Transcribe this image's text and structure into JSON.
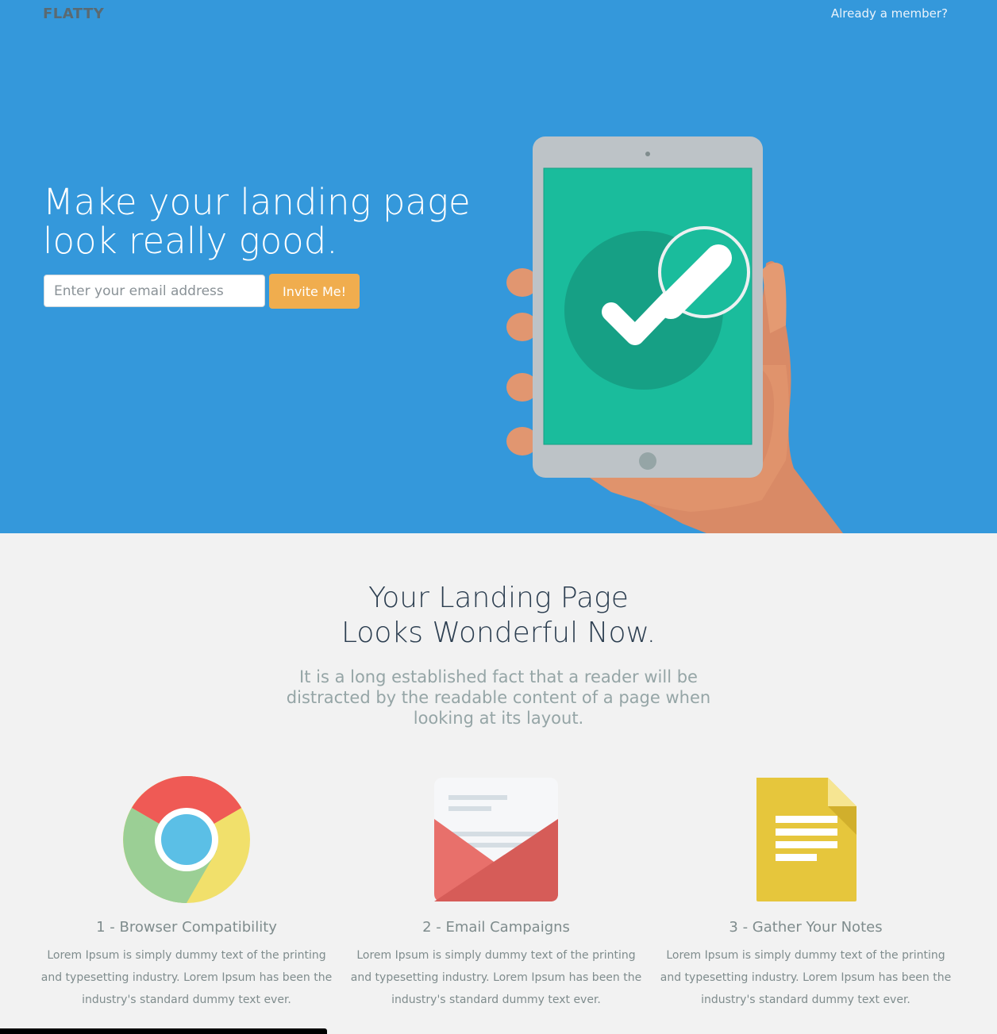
{
  "nav": {
    "brand": "FLATTY",
    "member_link": "Already a member?"
  },
  "hero": {
    "headline_line1": "Make your landing page",
    "headline_line2": "look really good.",
    "email_placeholder": "Enter your email address",
    "invite_label": "Invite Me!",
    "illustration": "hand-holding-tablet-checkmark-icon"
  },
  "intro": {
    "title_line1": "Your Landing Page",
    "title_line2": "Looks Wonderful Now.",
    "lead_line1": "It is a long established fact that a reader will be",
    "lead_line2": "distracted by the readable content of a page when",
    "lead_line3": "looking at its layout."
  },
  "features": [
    {
      "icon": "chrome-icon",
      "title": "1 - Browser Compatibility",
      "text": "Lorem Ipsum is simply dummy text of the printing and typesetting industry. Lorem Ipsum has been the industry's standard dummy text ever."
    },
    {
      "icon": "envelope-icon",
      "title": "2 - Email Campaigns",
      "text": "Lorem Ipsum is simply dummy text of the printing and typesetting industry. Lorem Ipsum has been the industry's standard dummy text ever."
    },
    {
      "icon": "document-icon",
      "title": "3 - Gather Your Notes",
      "text": "Lorem Ipsum is simply dummy text of the printing and typesetting industry. Lorem Ipsum has been the industry's standard dummy text ever."
    }
  ],
  "colors": {
    "hero_bg": "#3498db",
    "page_bg": "#f2f2f2",
    "accent_button": "#f0ad4e",
    "tablet_screen": "#1abc9c"
  }
}
